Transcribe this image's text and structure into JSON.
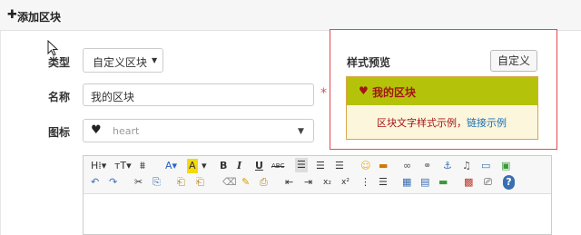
{
  "header": {
    "plus_icon": "plus-icon",
    "title": "添加区块"
  },
  "form": {
    "type_label": "类型",
    "type_value": "自定义区块",
    "name_label": "名称",
    "name_value": "我的区块",
    "required_mark": "*",
    "icon_label": "图标",
    "icon_value": "heart",
    "icon_glyph": "heart-icon"
  },
  "editor": {
    "toolbar_row1": [
      "H¹",
      "ᴛT",
      "⋕",
      "A",
      "A",
      "B",
      "I",
      "U",
      "ABC",
      "≡",
      "≡",
      "≡",
      "☺",
      "▬",
      "∞",
      "⚭",
      "⚓",
      "♪",
      "▭",
      "▣"
    ],
    "toolbar_row2": [
      "↶",
      "↷",
      "✂",
      "⎘",
      "⎗",
      "⎗",
      "⌫",
      "✎",
      "⎙",
      "⇤",
      "⇥",
      "x₂",
      "x²",
      "⋮",
      "☰",
      "▦",
      "▤",
      "▬",
      "▩",
      "⎚",
      "?"
    ]
  },
  "preview": {
    "title": "样式预览",
    "custom_button": "自定义",
    "block_title": "我的区块",
    "block_text": "区块文字样式示例，",
    "block_link": "链接示例",
    "colors": {
      "header_bg": "#b5c20a",
      "header_text": "#a31515",
      "body_bg": "#fcf6dd",
      "link": "#1a6fb5",
      "border": "#e5484d"
    }
  }
}
